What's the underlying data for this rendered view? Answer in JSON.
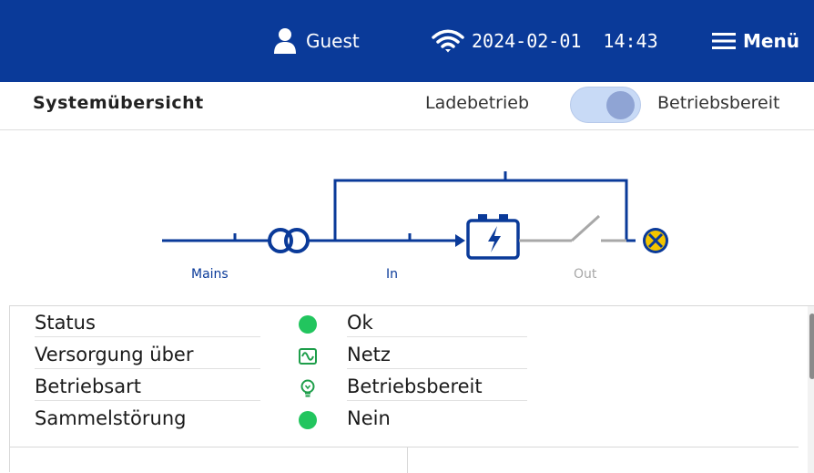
{
  "topbar": {
    "user_icon": "user-icon",
    "user_label": "Guest",
    "wifi_icon": "wifi-icon",
    "date": "2024-02-01",
    "time": "14:43",
    "menu_icon": "hamburger-icon",
    "menu_label": "Menü",
    "bar_color": "#0a3a99"
  },
  "header": {
    "title": "Systemübersicht",
    "mode_label": "Ladebetrieb",
    "toggle_state": "on",
    "state_label": "Betriebsbereit"
  },
  "diagram": {
    "labels": {
      "mains": "Mains",
      "in": "In",
      "out": "Out"
    },
    "icons": [
      "transformer-icon",
      "battery-charging-icon",
      "switch-open-icon",
      "lamp-icon"
    ],
    "line_color": "#0a3a99",
    "inactive_color": "#a8a8a8"
  },
  "status": {
    "rows": [
      {
        "label": "Status",
        "icon": "green-dot-icon",
        "value": "Ok"
      },
      {
        "label": "Versorgung über",
        "icon": "mains-wave-icon",
        "value": "Netz"
      },
      {
        "label": "Betriebsart",
        "icon": "bulb-icon",
        "value": "Betriebsbereit"
      },
      {
        "label": "Sammelstörung",
        "icon": "green-dot-icon",
        "value": "Nein"
      }
    ],
    "ok_color": "#22c55e"
  }
}
